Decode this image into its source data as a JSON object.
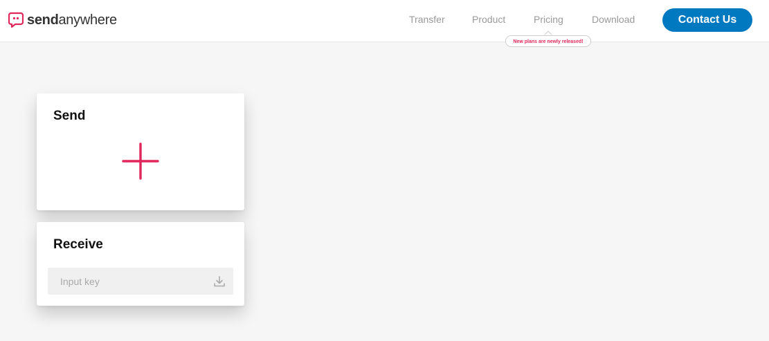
{
  "header": {
    "logo": {
      "bold": "send",
      "light": "anywhere"
    },
    "nav": [
      {
        "label": "Transfer"
      },
      {
        "label": "Product"
      },
      {
        "label": "Pricing"
      },
      {
        "label": "Download"
      }
    ],
    "contact_label": "Contact Us",
    "pricing_tooltip": "New plans are newly released!"
  },
  "send_card": {
    "title": "Send",
    "add_icon": "plus-icon"
  },
  "receive_card": {
    "title": "Receive",
    "key_placeholder": "Input key",
    "key_value": "",
    "action_icon": "download-icon"
  },
  "colors": {
    "brand_pink": "#e0265a",
    "contact_blue": "#0079c0",
    "nav_gray": "#999999",
    "background": "#f6f6f6"
  }
}
